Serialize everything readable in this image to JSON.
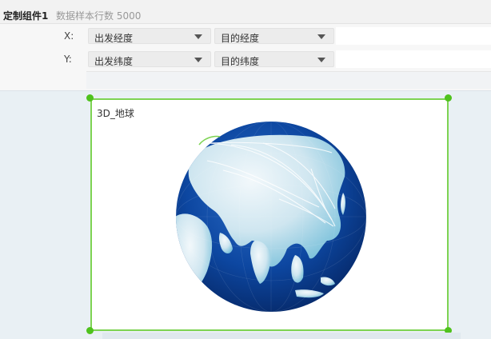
{
  "header": {
    "component_name": "定制组件1",
    "row_count_text": "数据样本行数 5000"
  },
  "fields": {
    "x": {
      "label": "X:",
      "start": "出发经度",
      "end": "目的经度"
    },
    "y": {
      "label": "Y:",
      "start": "出发纬度",
      "end": "目的纬度"
    }
  },
  "chart": {
    "title": "3D_地球"
  },
  "icons": {
    "dropdown": "chevron-down-icon",
    "resize": "resize-handle"
  },
  "colors": {
    "accent": "#4fc21d",
    "frame_border": "#7dd352",
    "ocean": "#0b3f93",
    "land": "#dfeef5"
  }
}
